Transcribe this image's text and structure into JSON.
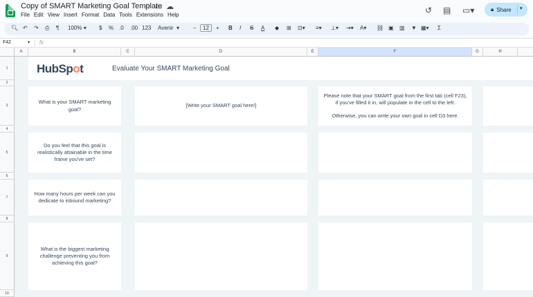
{
  "doc": {
    "title": "Copy of SMART Marketing Goal Template"
  },
  "menu": [
    "File",
    "Edit",
    "View",
    "Insert",
    "Format",
    "Data",
    "Tools",
    "Extensions",
    "Help"
  ],
  "share": {
    "label": "Share"
  },
  "toolbar": {
    "zoom": "100%",
    "currency": "$",
    "percent": "%",
    "dec_dec": ".0",
    "dec_inc": ".00",
    "num_fmt": "123",
    "font": "Avenir",
    "font_size": "12"
  },
  "formula_bar": {
    "cell_ref": "F42",
    "fx": "fx"
  },
  "columns": [
    "A",
    "B",
    "C",
    "D",
    "E",
    "F",
    "G",
    "H"
  ],
  "rows": [
    "1",
    "2",
    "3",
    "4",
    "5",
    "6",
    "7",
    "8",
    "9",
    "10"
  ],
  "sheet": {
    "logo": {
      "text_a": "HubSp",
      "text_b": "o",
      "text_c": "t"
    },
    "heading": "Evaluate Your SMART Marketing Goal",
    "q1": "What is your SMART marketing goal?",
    "q1_answer": "[Write your SMART goal here!]",
    "note_1": "Please note that your SMART goal from the first tab (cell F23), if you've filled it in, will populate in the cell to the left.",
    "note_2": "Otherwise, you can write your own goal in cell D3 here.",
    "q2": "Do you feel that this goal is realistically attainable in the time frame you've set?",
    "q3": "How many hours per week can you dedicate to inbound marketing?",
    "q4": "What is the biggest marketing challenge preventing you from achieving this goal?"
  },
  "colors": {
    "accent": "#0f9d58",
    "share_bg": "#c2e7ff",
    "hubspot_orange": "#ff7a59",
    "text_dark": "#33475b"
  }
}
